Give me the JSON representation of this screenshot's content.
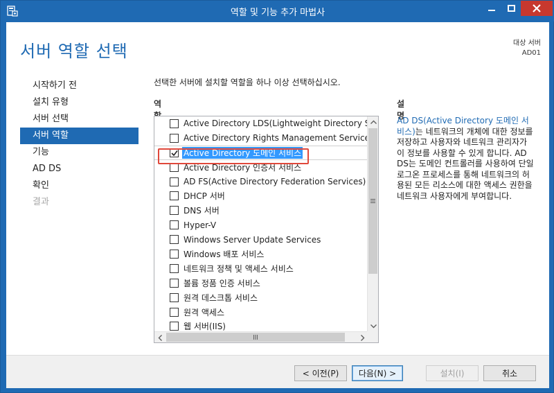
{
  "window": {
    "title": "역할 및 기능 추가 마법사"
  },
  "page": {
    "title": "서버 역할 선택",
    "destination_label": "대상 서버",
    "destination_server": "AD01"
  },
  "nav": {
    "items": [
      {
        "label": "시작하기 전",
        "state": "normal"
      },
      {
        "label": "설치 유형",
        "state": "normal"
      },
      {
        "label": "서버 선택",
        "state": "normal"
      },
      {
        "label": "서버 역할",
        "state": "active"
      },
      {
        "label": "기능",
        "state": "normal"
      },
      {
        "label": "AD DS",
        "state": "normal"
      },
      {
        "label": "확인",
        "state": "normal"
      },
      {
        "label": "결과",
        "state": "disabled"
      }
    ]
  },
  "main": {
    "instruction": "선택한 서버에 설치할 역할을 하나 이상 선택하십시오.",
    "roles_header": "역할",
    "description_header": "설명",
    "roles": [
      {
        "label": "Active Directory LDS(Lightweight Directory Servi",
        "checked": false
      },
      {
        "label": "Active Directory Rights Management Services",
        "checked": false
      },
      {
        "label": "Active Directory 도메인 서비스",
        "checked": true
      },
      {
        "label": "Active Directory 인증서 서비스",
        "checked": false
      },
      {
        "label": "AD FS(Active Directory Federation Services)",
        "checked": false
      },
      {
        "label": "DHCP 서버",
        "checked": false
      },
      {
        "label": "DNS 서버",
        "checked": false
      },
      {
        "label": "Hyper-V",
        "checked": false
      },
      {
        "label": "Windows Server Update Services",
        "checked": false
      },
      {
        "label": "Windows 배포 서비스",
        "checked": false
      },
      {
        "label": "네트워크 정책 및 액세스 서비스",
        "checked": false
      },
      {
        "label": "볼륨 정품 인증 서비스",
        "checked": false
      },
      {
        "label": "원격 데스크톱 서비스",
        "checked": false
      },
      {
        "label": "원격 액세스",
        "checked": false
      },
      {
        "label": "웹 서버(IIS)",
        "checked": false
      }
    ],
    "description_link": "AD DS(Active Directory 도메인 서비스)",
    "description_body": "는 네트워크의 개체에 대한 정보를 저장하고 사용자와 네트워크 관리자가 이 정보를 사용할 수 있게 합니다. AD DS는 도메인 컨트롤러를 사용하여 단일 로그온 프로세스를 통해 네트워크의 허용된 모든 리소스에 대한 액세스 권한을 네트워크 사용자에게 부여합니다."
  },
  "footer": {
    "prev_label": "< 이전(P)",
    "next_label": "다음(N) >",
    "install_label": "설치(I)",
    "cancel_label": "취소"
  },
  "colors": {
    "accent": "#1f6ab3",
    "selection": "#3399ff",
    "highlight_box": "#e0483b",
    "close_button": "#c7382e"
  }
}
